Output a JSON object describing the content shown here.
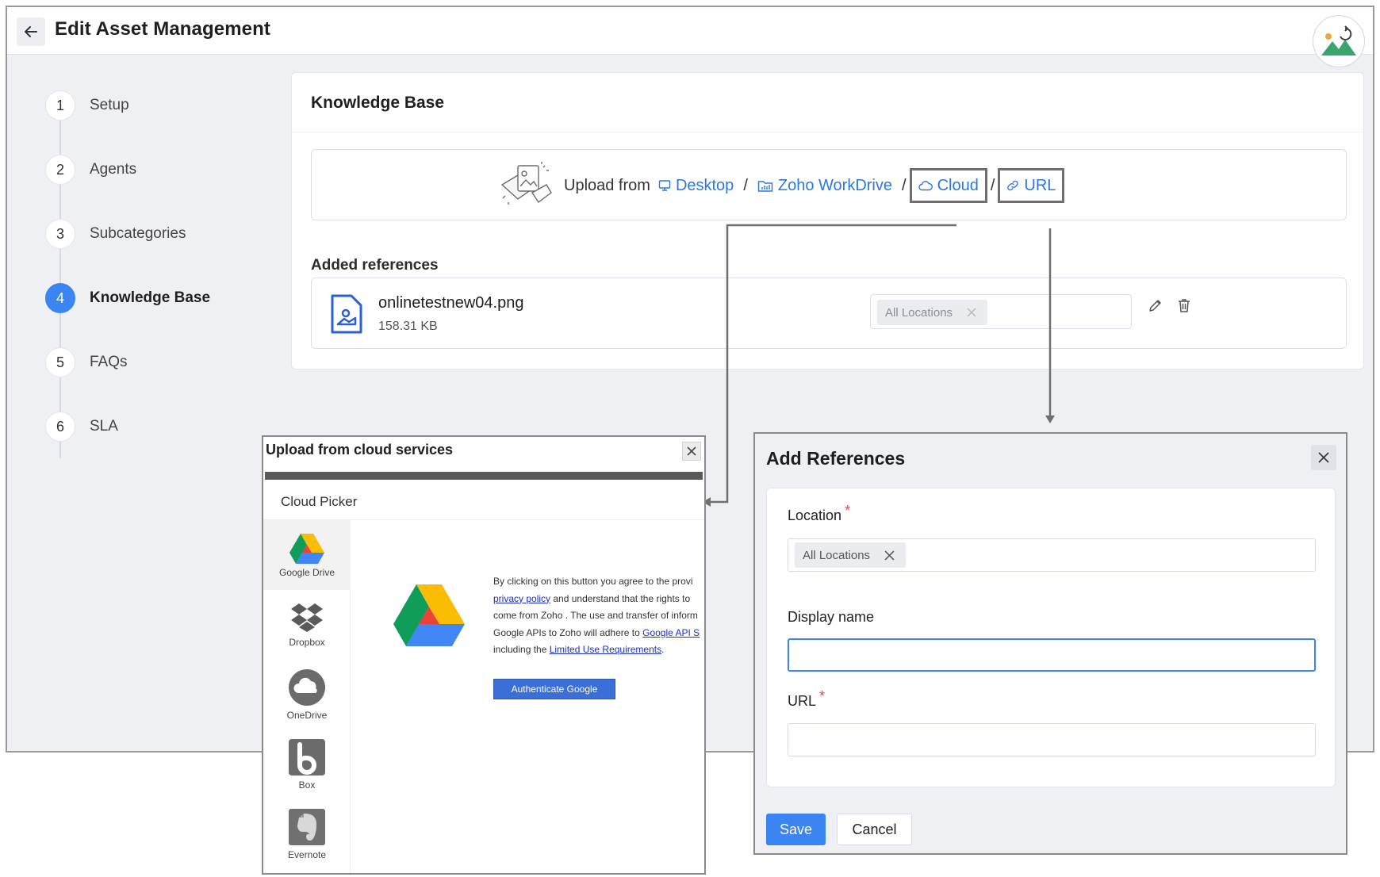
{
  "header": {
    "title": "Edit Asset Management"
  },
  "steps": [
    {
      "num": "1",
      "label": "Setup"
    },
    {
      "num": "2",
      "label": "Agents"
    },
    {
      "num": "3",
      "label": "Subcategories"
    },
    {
      "num": "4",
      "label": "Knowledge Base"
    },
    {
      "num": "5",
      "label": "FAQs"
    },
    {
      "num": "6",
      "label": "SLA"
    }
  ],
  "active_step": 4,
  "kb": {
    "title": "Knowledge Base",
    "upload_from": "Upload from",
    "sources": {
      "desktop": "Desktop",
      "workdrive": "Zoho WorkDrive",
      "cloud": "Cloud",
      "url": "URL"
    },
    "separator": "/",
    "added_references": "Added references",
    "file": {
      "name": "onlinetestnew04.png",
      "size": "158.31 KB",
      "location_chip": "All Locations"
    }
  },
  "cloud_dialog": {
    "title": "Upload from cloud services",
    "picker_title": "Cloud Picker",
    "providers": [
      "Google Drive",
      "Dropbox",
      "OneDrive",
      "Box",
      "Evernote"
    ],
    "selected_provider": "Google Drive",
    "consent": {
      "line1": "By clicking on this button you agree to the provi",
      "link1": "privacy policy",
      "line2_rest": " and understand that the rights to",
      "line3": "come from Zoho . The use and transfer of inform",
      "line4_start": "Google APIs to Zoho will adhere to ",
      "link2": "Google API S",
      "line5_start": "including the ",
      "link3": "Limited Use Requirements",
      "line5_end": "."
    },
    "auth_button": "Authenticate Google"
  },
  "ref_dialog": {
    "title": "Add References",
    "location_label": "Location",
    "location_chip": "All Locations",
    "display_name_label": "Display name",
    "display_name_value": "",
    "url_label": "URL",
    "url_value": "",
    "required_mark": "*",
    "save": "Save",
    "cancel": "Cancel"
  },
  "colors": {
    "accent": "#3a85f1",
    "link": "#2b77e6",
    "required": "#e4473a",
    "google_auth": "#3b6fd8"
  }
}
